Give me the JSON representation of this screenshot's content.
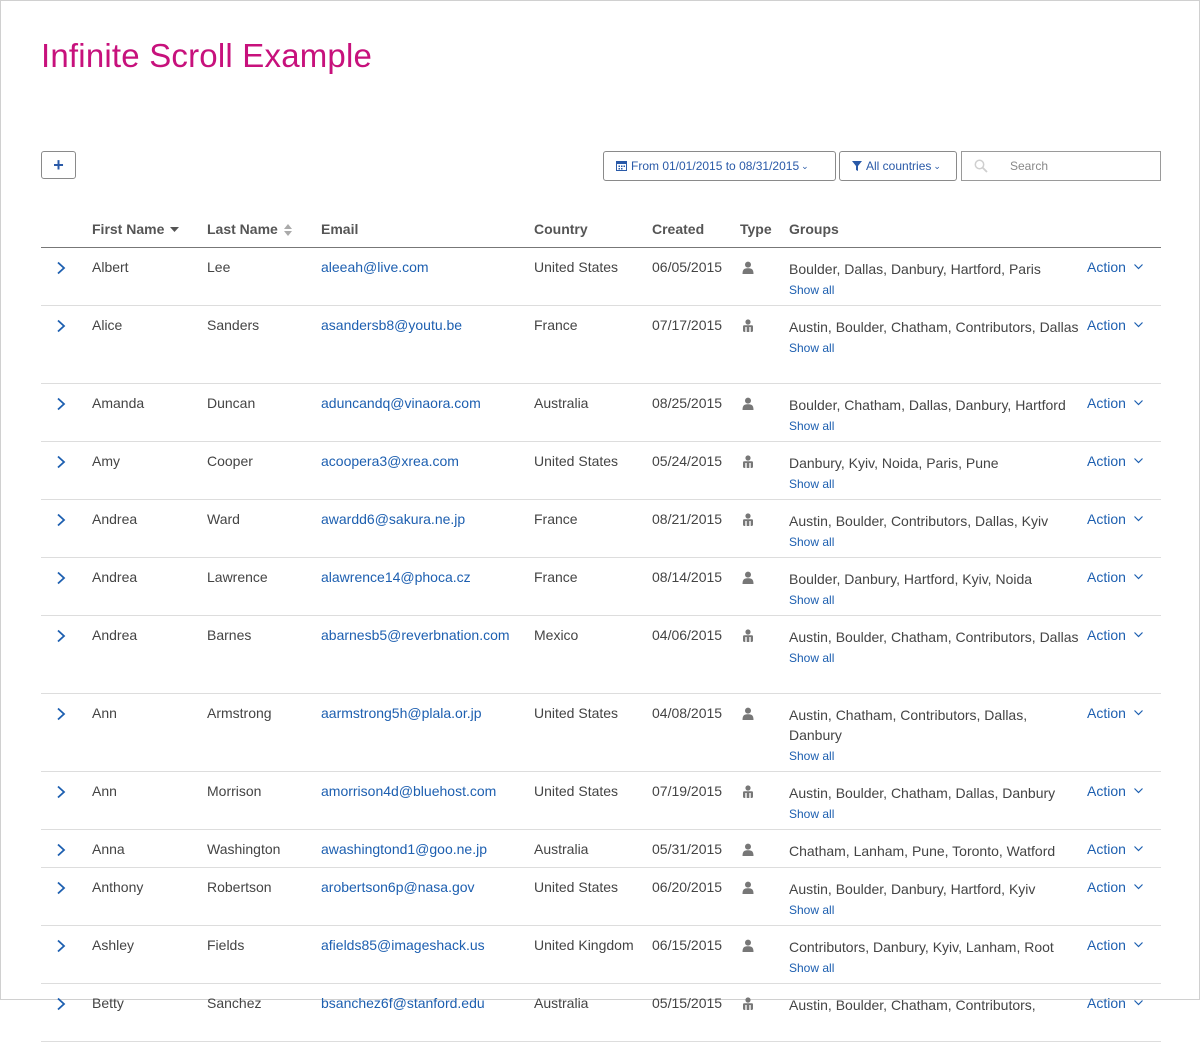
{
  "page": {
    "title": "Infinite Scroll Example"
  },
  "toolbar": {
    "add_label": "+",
    "date_filter": "From 01/01/2015 to 08/31/2015",
    "country_filter": "All countries",
    "search_placeholder": "Search",
    "search_value": ""
  },
  "columns": {
    "first_name": "First Name",
    "last_name": "Last Name",
    "email": "Email",
    "country": "Country",
    "created": "Created",
    "type": "Type",
    "groups": "Groups"
  },
  "show_all_label": "Show all",
  "action_label": "Action",
  "colors": {
    "title": "#c7117c",
    "link": "#1d5fb0",
    "text": "#444444"
  },
  "rows": [
    {
      "first": "Albert",
      "last": "Lee",
      "email": "aleeah@live.com",
      "country": "United States",
      "created": "06/05/2015",
      "type": "user-icon",
      "groups": "Boulder, Dallas, Danbury, Hartford, Paris",
      "show_all": true
    },
    {
      "first": "Alice",
      "last": "Sanders",
      "email": "asandersb8@youtu.be",
      "country": "France",
      "created": "07/17/2015",
      "type": "group-icon",
      "groups": "Austin, Boulder, Chatham, Contributors, Dallas",
      "show_all": true
    },
    {
      "first": "Amanda",
      "last": "Duncan",
      "email": "aduncandq@vinaora.com",
      "country": "Australia",
      "created": "08/25/2015",
      "type": "user-icon",
      "groups": "Boulder, Chatham, Dallas, Danbury, Hartford",
      "show_all": true
    },
    {
      "first": "Amy",
      "last": "Cooper",
      "email": "acoopera3@xrea.com",
      "country": "United States",
      "created": "05/24/2015",
      "type": "group-icon",
      "groups": "Danbury, Kyiv, Noida, Paris, Pune",
      "show_all": true
    },
    {
      "first": "Andrea",
      "last": "Ward",
      "email": "awardd6@sakura.ne.jp",
      "country": "France",
      "created": "08/21/2015",
      "type": "group-icon",
      "groups": "Austin, Boulder, Contributors, Dallas, Kyiv",
      "show_all": true
    },
    {
      "first": "Andrea",
      "last": "Lawrence",
      "email": "alawrence14@phoca.cz",
      "country": "France",
      "created": "08/14/2015",
      "type": "user-icon",
      "groups": "Boulder, Danbury, Hartford, Kyiv, Noida",
      "show_all": true
    },
    {
      "first": "Andrea",
      "last": "Barnes",
      "email": "abarnesb5@reverbnation.com",
      "country": "Mexico",
      "created": "04/06/2015",
      "type": "group-icon",
      "groups": "Austin, Boulder, Chatham, Contributors, Dallas",
      "show_all": true
    },
    {
      "first": "Ann",
      "last": "Armstrong",
      "email": "aarmstrong5h@plala.or.jp",
      "country": "United States",
      "created": "04/08/2015",
      "type": "user-icon",
      "groups": "Austin, Chatham, Contributors, Dallas, Danbury",
      "show_all": true
    },
    {
      "first": "Ann",
      "last": "Morrison",
      "email": "amorrison4d@bluehost.com",
      "country": "United States",
      "created": "07/19/2015",
      "type": "group-icon",
      "groups": "Austin, Boulder, Chatham, Dallas, Danbury",
      "show_all": true
    },
    {
      "first": "Anna",
      "last": "Washington",
      "email": "awashingtond1@goo.ne.jp",
      "country": "Australia",
      "created": "05/31/2015",
      "type": "user-icon",
      "groups": "Chatham, Lanham, Pune, Toronto, Watford",
      "show_all": false
    },
    {
      "first": "Anthony",
      "last": "Robertson",
      "email": "arobertson6p@nasa.gov",
      "country": "United States",
      "created": "06/20/2015",
      "type": "user-icon",
      "groups": "Austin, Boulder, Danbury, Hartford, Kyiv",
      "show_all": true
    },
    {
      "first": "Ashley",
      "last": "Fields",
      "email": "afields85@imageshack.us",
      "country": "United Kingdom",
      "created": "06/15/2015",
      "type": "user-icon",
      "groups": "Contributors, Danbury, Kyiv, Lanham, Root",
      "show_all": true
    },
    {
      "first": "Betty",
      "last": "Sanchez",
      "email": "bsanchez6f@stanford.edu",
      "country": "Australia",
      "created": "05/15/2015",
      "type": "group-icon",
      "groups": "Austin, Boulder, Chatham, Contributors,",
      "show_all": false
    }
  ]
}
